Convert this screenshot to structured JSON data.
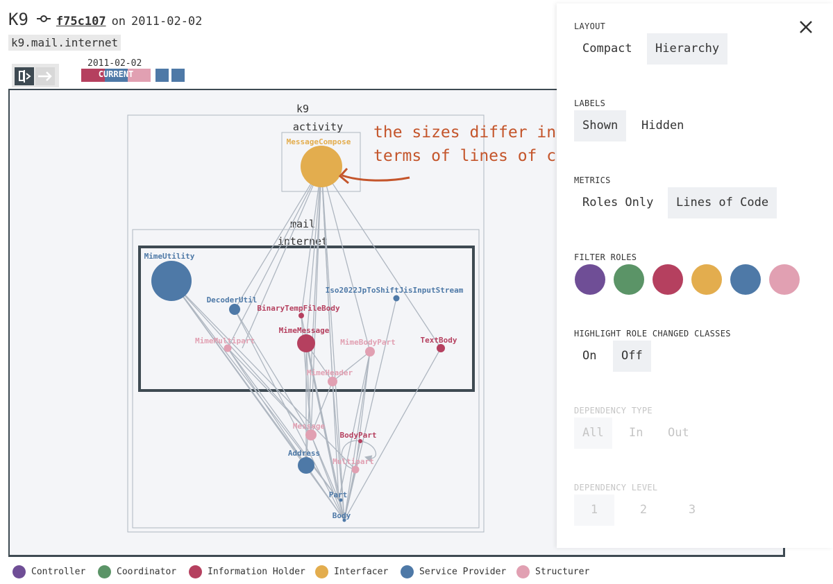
{
  "header": {
    "repo_name": "K9",
    "commit_hash": "f75c107",
    "on_text": "on",
    "commit_date": "2011-02-02",
    "package": "k9.mail.internet"
  },
  "timeline": {
    "date": "2011-02-02",
    "current_label": "CURRENT"
  },
  "graph": {
    "packages": {
      "k9": "k9",
      "activity": "activity",
      "mail": "mail",
      "internet": "internet"
    },
    "nodes": {
      "message_compose": "MessageCompose",
      "mime_utility": "MimeUtility",
      "decoder_util": "DecoderUtil",
      "binary_temp_file_body": "BinaryTempFileBody",
      "iso2022": "Iso2022JpToShiftJisInputStream",
      "mime_multipart": "MimeMultipart",
      "mime_message": "MimeMessage",
      "mime_body_part": "MimeBodyPart",
      "text_body": "TextBody",
      "mime_header": "MimeHeader",
      "message": "Message",
      "body_part": "BodyPart",
      "address": "Address",
      "multipart": "Multipart",
      "part": "Part",
      "body": "Body"
    },
    "annotation": {
      "line1": "the sizes differ in",
      "line2": "terms of lines of code"
    }
  },
  "sidebar": {
    "layout": {
      "label": "LAYOUT",
      "compact": "Compact",
      "hierarchy": "Hierarchy"
    },
    "labels": {
      "label": "LABELS",
      "shown": "Shown",
      "hidden": "Hidden"
    },
    "metrics": {
      "label": "METRICS",
      "roles_only": "Roles Only",
      "lines_of_code": "Lines of Code"
    },
    "filter_roles": {
      "label": "FILTER ROLES"
    },
    "highlight": {
      "label": "HIGHLIGHT ROLE CHANGED CLASSES",
      "on": "On",
      "off": "Off"
    },
    "dependency_type": {
      "label": "DEPENDENCY TYPE",
      "all": "All",
      "in": "In",
      "out": "Out"
    },
    "dependency_level": {
      "label": "DEPENDENCY LEVEL",
      "l1": "1",
      "l2": "2",
      "l3": "3"
    }
  },
  "legend": {
    "controller": "Controller",
    "coordinator": "Coordinator",
    "information_holder": "Information Holder",
    "interfacer": "Interfacer",
    "service_provider": "Service Provider",
    "structurer": "Structurer"
  },
  "colors": {
    "controller": "#6f4e96",
    "coordinator": "#5b9467",
    "information_holder": "#b5405f",
    "interfacer": "#e3ad4e",
    "service_provider": "#4e79a7",
    "structurer": "#e1a0b2",
    "annotation": "#c4552b",
    "edge": "#aeb6c0",
    "frame": "#3e4a52"
  },
  "icons": {
    "commit": "commit-icon",
    "toggle": "split-view-toggle-icon",
    "close": "close-icon"
  }
}
